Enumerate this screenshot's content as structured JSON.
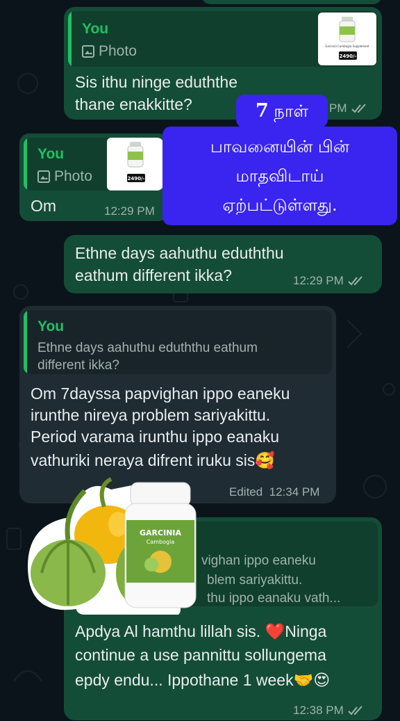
{
  "chat": {
    "msg1": {
      "quote_name": "You",
      "quote_sub": "Photo",
      "text": "Sis ithu ninge eduththe thane enakkitte?",
      "time": "12:29 PM",
      "time_partial": "PM"
    },
    "msg2": {
      "quote_name": "You",
      "quote_sub": "Photo",
      "text": "Om",
      "time": "12:29 PM"
    },
    "msg3": {
      "text": "Ethne days aahuthu eduththu eathum different ikka?",
      "time": "12:29 PM"
    },
    "msg4": {
      "quote_name": "You",
      "quote_text": "Ethne days aahuthu eduththu eathum different ikka?",
      "text_line1": "Om 7dayssa papvighan ippo eaneku",
      "text_line2": "irunthe nireya  problem sariyakittu.",
      "text_line3": "Period varama irunthu  ippo eanaku",
      "text_line4": "vathuriki  neraya difrent iruku sis🥰",
      "time": "Edited  12:34 PM"
    },
    "msg5": {
      "quote_line1": "vighan ippo eaneku",
      "quote_line2": "blem sariyakittu.",
      "quote_line3": "thu  ippo eanaku vath...",
      "text_line1": "Apdya Al hamthu lillah sis. ❤️Ninga",
      "text_line2": "continue a use pannittu sollungema",
      "text_line3": "epdy endu... Ippothane 1 week🤝😍",
      "time": "12:38 PM"
    }
  },
  "overlay": {
    "line1_num": "7",
    "line1_word": "நாள்",
    "line2": "பாவனையின் பின்",
    "line3": "மாதவிடாய்",
    "line4": "ஏற்பட்டுள்ளது."
  },
  "product": {
    "thumb_label": "Garcinia Cambogia Supplement",
    "thumb_price": "2490/-",
    "jar_brand": "GARCINIA",
    "jar_sub": "Cambogia"
  },
  "colors": {
    "background": "#0b141a",
    "outgoing_bubble": "#144d37",
    "incoming_bubble": "#1f2c34",
    "accent": "#21c063",
    "overlay": "#3a24ef"
  }
}
